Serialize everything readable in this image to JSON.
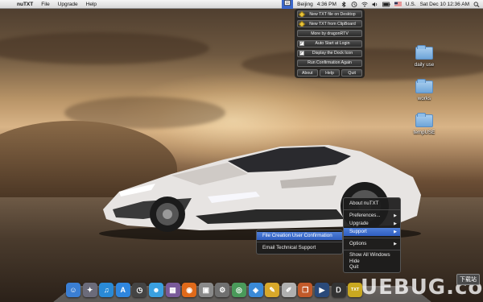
{
  "menubar": {
    "app_name": "nuTXT",
    "menus": [
      "File",
      "Upgrade",
      "Help"
    ],
    "location": "Beijing",
    "time_short": "4:36 PM",
    "language": "U.S.",
    "clock": "Sat Dec 10  12:36 AM"
  },
  "hud": {
    "buttons": [
      {
        "label": "New TXT file on Desktop",
        "lead": "diamond"
      },
      {
        "label": "New TXT from ClipBoard",
        "lead": "diamond"
      },
      {
        "label": "More by dragonRTV",
        "lead": "none"
      },
      {
        "label": "Auto Start at Login",
        "lead": "check",
        "check_mark": "✓"
      },
      {
        "label": "Display the Dock Icon",
        "lead": "check",
        "check_mark": "✓"
      },
      {
        "label": "Run Confirmation Again",
        "lead": "none"
      }
    ],
    "bottom_buttons": [
      "About",
      "Help",
      "Quit"
    ]
  },
  "desktop_folders": [
    "daily use",
    "works",
    "tempUSE"
  ],
  "dock_menu": {
    "items": [
      "About  nuTXT",
      "Preferences...",
      "Upgrade",
      "Support",
      "Options",
      "Show All Windows",
      "Hide",
      "Quit"
    ],
    "submenu_arrow": "▶"
  },
  "support_submenu": {
    "items": [
      "File Creation User Confirmation",
      "Email Technical Support"
    ]
  },
  "dock": {
    "icons": [
      {
        "name": "finder-icon",
        "glyph": "☺",
        "color": "#3b7fd4"
      },
      {
        "name": "launchpad-icon",
        "glyph": "✦",
        "color": "#6b6b7a"
      },
      {
        "name": "itunes-icon",
        "glyph": "♫",
        "color": "#2a8ad6"
      },
      {
        "name": "app-store-icon",
        "glyph": "A",
        "color": "#2f86de"
      },
      {
        "name": "dashboard-icon",
        "glyph": "◷",
        "color": "#444444"
      },
      {
        "name": "messenger-icon",
        "glyph": "☻",
        "color": "#3aa0e0"
      },
      {
        "name": "photos-icon",
        "glyph": "▦",
        "color": "#7a5a9a"
      },
      {
        "name": "firefox-icon",
        "glyph": "◉",
        "color": "#e06a1a"
      },
      {
        "name": "preview-icon",
        "glyph": "▣",
        "color": "#8a8a8a"
      },
      {
        "name": "system-preferences-icon",
        "glyph": "⚙",
        "color": "#707070"
      },
      {
        "name": "maps-icon",
        "glyph": "◎",
        "color": "#4a9a5a"
      },
      {
        "name": "safari-icon",
        "glyph": "◈",
        "color": "#3a8ad8"
      },
      {
        "name": "stickies-icon",
        "glyph": "✎",
        "color": "#d8a82a"
      },
      {
        "name": "textedit-icon",
        "glyph": "✐",
        "color": "#b0b0b0"
      },
      {
        "name": "books-icon",
        "glyph": "❐",
        "color": "#c25a2a"
      },
      {
        "name": "quicktime-icon",
        "glyph": "▶",
        "color": "#2a4a7a"
      },
      {
        "name": "dictionary-icon",
        "glyph": "Ꭰ",
        "color": "#333333"
      },
      {
        "name": "nutxt-icon",
        "glyph": "TXT",
        "color": "#c9a820"
      }
    ]
  },
  "watermark": {
    "text": "UEBUG.com",
    "badge": "下载站"
  }
}
